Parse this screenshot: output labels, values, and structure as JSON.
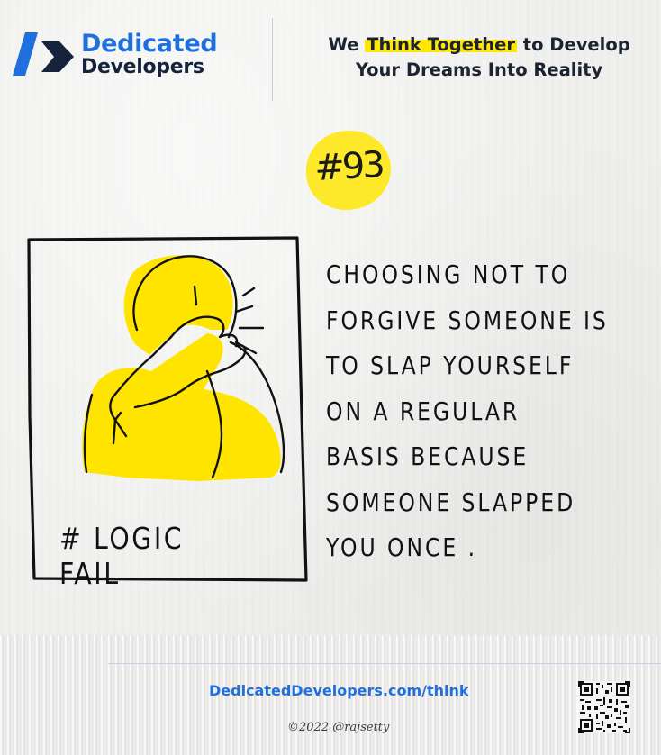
{
  "header": {
    "brand_line1": "Dedicated",
    "brand_line2": "Developers",
    "tagline_prefix": "We ",
    "tagline_highlight": "Think Together",
    "tagline_suffix": " to Develop",
    "tagline_line2": "Your Dreams Into Reality"
  },
  "comic": {
    "number": "#93",
    "panel_caption": "# LOGIC FAIL",
    "quote_lines": [
      "CHOOSING NOT TO",
      "FORGIVE SOMEONE IS",
      "TO SLAP YOURSELF",
      "ON A REGULAR",
      "BASIS BECAUSE",
      "SOMEONE SLAPPED",
      "YOU ONCE ."
    ]
  },
  "footer": {
    "url": "DedicatedDevelopers.com/think",
    "copyright": "©2022 @rajsetty"
  },
  "colors": {
    "brand_blue": "#1f6fdc",
    "brand_dark": "#15233c",
    "highlight_yellow": "#ffe800",
    "paper": "#efefed"
  },
  "icons": {
    "logo": "dedicated-developers-logo",
    "qr": "qr-code-icon"
  }
}
